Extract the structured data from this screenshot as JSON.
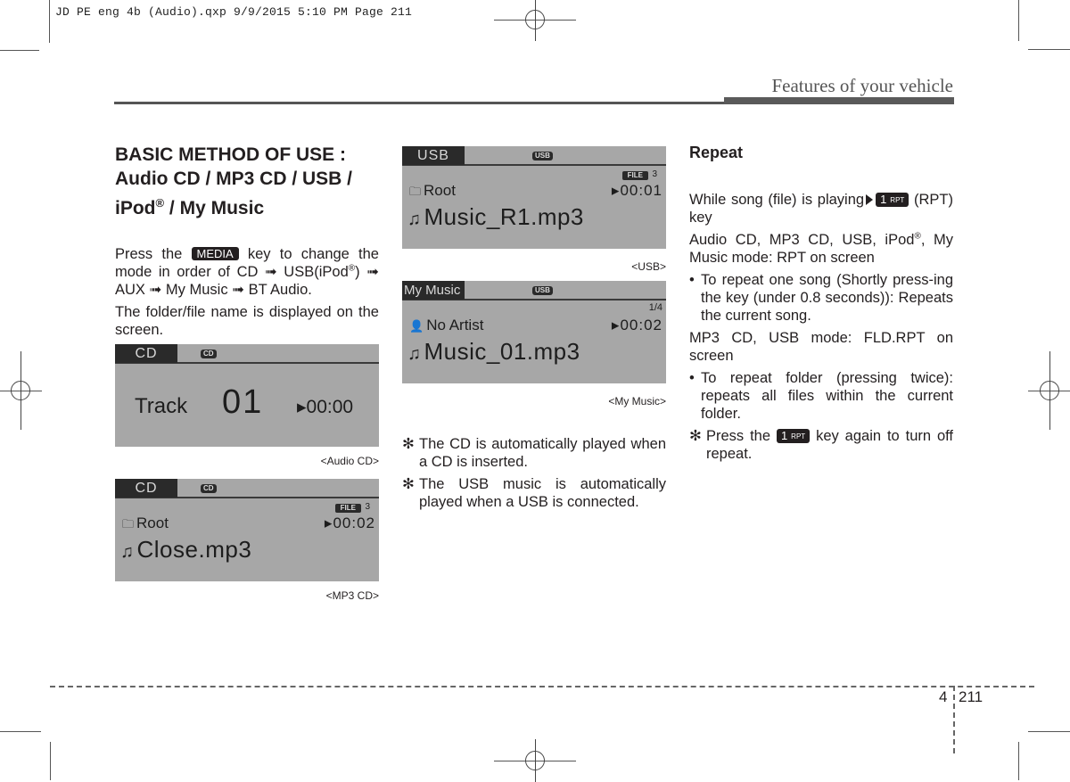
{
  "slug": "JD PE eng 4b (Audio).qxp  9/9/2015  5:10 PM  Page 211",
  "running_head": "Features of your vehicle",
  "left_column": {
    "title_line1": "BASIC METHOD OF USE :",
    "title_line2": "Audio CD / MP3 CD / USB /",
    "title_line3_a": "iPod",
    "title_line3_reg": "®",
    "title_line3_b": " / My Music",
    "p1_a": "Press the ",
    "media_key": "MEDIA",
    "p1_b": " key to change the mode in order of CD ➟ USB(iPod",
    "p1_reg": "®",
    "p1_c": ") ➟ AUX ➟ My Music ➟ BT Audio.",
    "p2": "The folder/file name is displayed on the screen."
  },
  "screens": {
    "audio_cd": {
      "mode": "CD",
      "source_badge": "CD",
      "track_label": "Track",
      "track_number": "01",
      "time": "▸00:00",
      "caption": "<Audio CD>"
    },
    "mp3_cd": {
      "mode": "CD",
      "source_badge": "CD",
      "file_badge": "FILE",
      "file_number": "3",
      "folder_icon": "folder-icon",
      "folder": "Root",
      "time": "▸00:02",
      "note_icon": "music-note-icon",
      "filename": "Close.mp3",
      "caption": "<MP3 CD>"
    },
    "usb": {
      "mode": "USB",
      "source_badge": "USB",
      "file_badge": "FILE",
      "file_number": "3",
      "folder_icon": "folder-icon",
      "folder": "Root",
      "time": "▸00:01",
      "note_icon": "music-note-icon",
      "filename": "Music_R1.mp3",
      "caption": "<USB>"
    },
    "my_music": {
      "mode": "My Music",
      "source_badge": "USB",
      "index": "1/4",
      "artist_icon": "person-icon",
      "artist": "No Artist",
      "time": "▸00:02",
      "note_icon": "music-note-icon",
      "filename": "Music_01.mp3",
      "caption": "<My Music>"
    }
  },
  "middle_notes": [
    "The CD is automatically played when a CD is inserted.",
    "The USB music is automatically played when a USB is connected."
  ],
  "note_mark": "✻",
  "repeat": {
    "heading": "Repeat",
    "p1_a": "While song (file) is playing",
    "rpt_key_num": "1",
    "rpt_key_label": "RPT",
    "p1_b": "(RPT) key",
    "p2_a": "Audio CD, MP3 CD, USB, iPod",
    "p2_reg": "®",
    "p2_b": ", My Music mode: RPT on screen",
    "bullet1": "To repeat one song (Shortly press-ing the key (under 0.8 seconds)): Repeats the current song.",
    "p3": "MP3 CD, USB mode: FLD.RPT on screen",
    "bullet2": "To repeat folder (pressing twice): repeats all files within the current folder.",
    "note_a": "Press the",
    "note_b": "key again to turn off repeat."
  },
  "bullet_mark": "•",
  "footer": {
    "chapter": "4",
    "page": "211"
  }
}
